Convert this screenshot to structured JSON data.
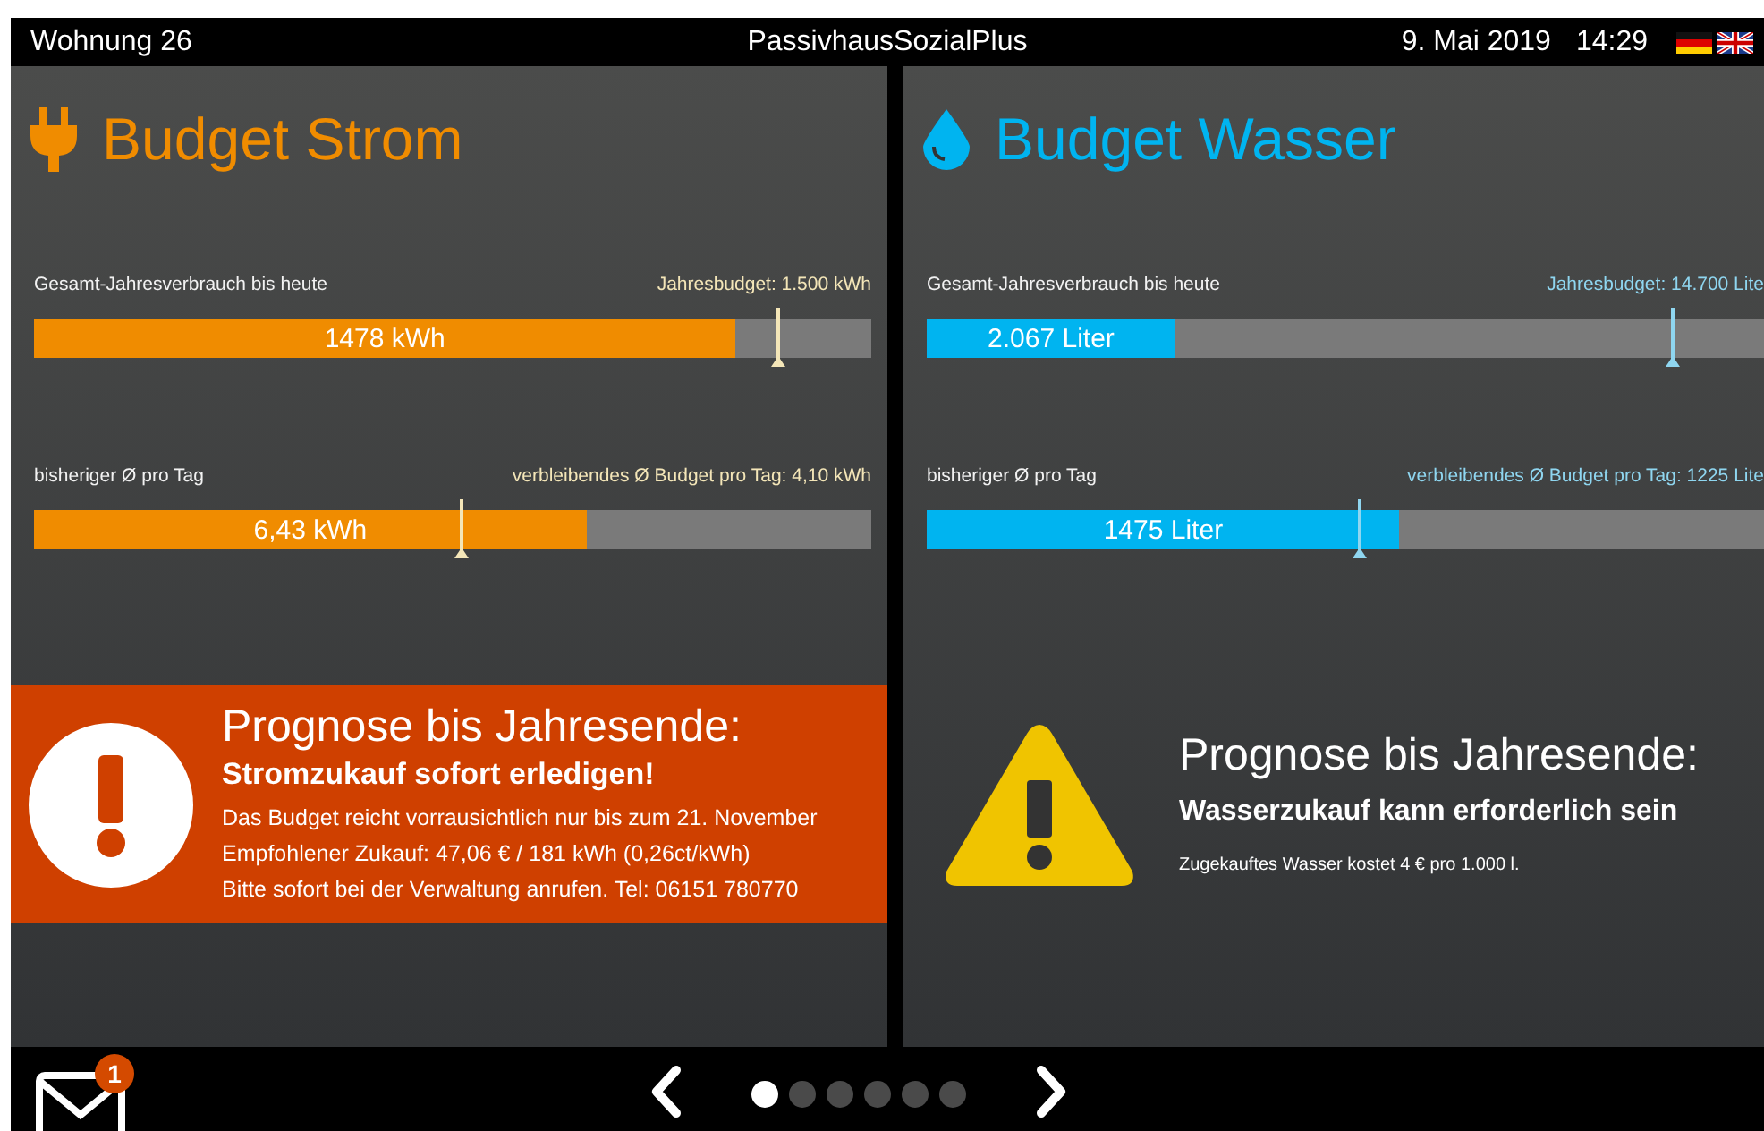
{
  "header": {
    "apartment": "Wohnung 26",
    "app_name": "PassivhausSozialPlus",
    "date": "9. Mai 2019",
    "time": "14:29"
  },
  "panels": [
    {
      "kind": "electricity",
      "title": "Budget Strom",
      "color": "#f08c00",
      "meters": [
        {
          "label": "Gesamt-Jahresverbrauch bis heute",
          "budget_label": "Jahresbudget: 1.500 kWh",
          "reading": "1478 kWh",
          "level": 0.838,
          "marker": {
            "level": 0.889
          }
        },
        {
          "label": "bisheriger Ø pro Tag",
          "budget_label": "verbleibendes Ø Budget pro Tag: 4,10 kWh",
          "reading": "6,43 kWh",
          "level": 0.66,
          "marker": {
            "level": 0.51
          }
        }
      ],
      "alert": {
        "kind": "critical",
        "heading": "Prognose bis Jahresende:",
        "subheading": "Stromzukauf sofort erledigen!",
        "lines": [
          "Das Budget reicht vorrausichtlich nur bis zum 21. November",
          "Empfohlener Zukauf: 47,06 € / 181 kWh (0,26ct/kWh)",
          "Bitte sofort bei der Verwaltung anrufen. Tel: 06151 780770"
        ]
      }
    },
    {
      "kind": "water",
      "title": "Budget Wasser",
      "color": "#00b4f0",
      "meters": [
        {
          "label": "Gesamt-Jahresverbrauch bis heute",
          "budget_label": "Jahresbudget: 14.700 Lite",
          "reading": "2.067 Liter",
          "level": 0.297,
          "marker": {
            "level": 0.89
          }
        },
        {
          "label": "bisheriger Ø pro Tag",
          "budget_label": "verbleibendes Ø Budget pro Tag: 1225 Lite",
          "reading": "1475 Liter",
          "level": 0.565,
          "marker": {
            "level": 0.517
          }
        }
      ],
      "alert": {
        "kind": "warning",
        "heading": "Prognose bis Jahresende:",
        "subheading": "Wasserzukauf kann erforderlich sein",
        "lines": [
          "Zugekauftes Wasser kostet 4 € pro 1.000 l."
        ]
      }
    }
  ],
  "footer": {
    "unread_count": "1",
    "pages": [
      {
        "selected": true
      },
      {
        "selected": false
      },
      {
        "selected": false
      },
      {
        "selected": false
      },
      {
        "selected": false
      },
      {
        "selected": false
      }
    ]
  }
}
